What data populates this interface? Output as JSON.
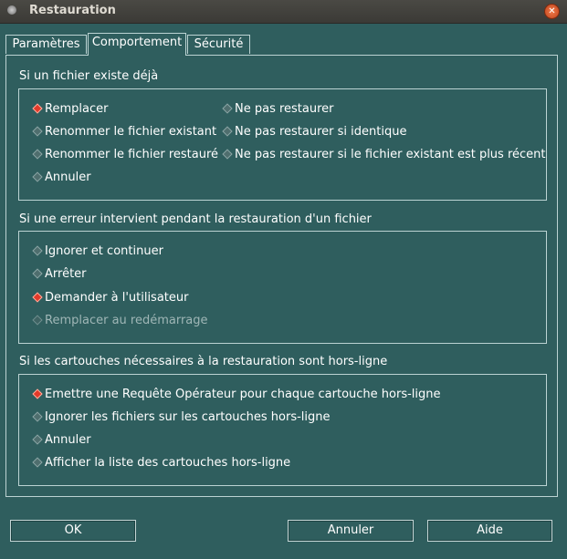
{
  "window": {
    "title": "Restauration"
  },
  "tabs": [
    {
      "label": "Paramètres"
    },
    {
      "label": "Comportement"
    },
    {
      "label": "Sécurité"
    }
  ],
  "sections": [
    {
      "title": "Si un fichier existe déjà",
      "options": [
        {
          "label": "Remplacer",
          "selected": true
        },
        {
          "label": "Renommer le fichier existant",
          "selected": false
        },
        {
          "label": "Renommer le fichier restauré",
          "selected": false
        },
        {
          "label": "Annuler",
          "selected": false
        },
        {
          "label": "Ne pas restaurer",
          "selected": false
        },
        {
          "label": "Ne pas restaurer si identique",
          "selected": false
        },
        {
          "label": "Ne pas restaurer si le fichier existant est plus récent",
          "selected": false
        }
      ]
    },
    {
      "title": "Si une erreur intervient pendant la restauration d'un fichier",
      "options": [
        {
          "label": "Ignorer et continuer",
          "selected": false
        },
        {
          "label": "Arrêter",
          "selected": false
        },
        {
          "label": "Demander à l'utilisateur",
          "selected": true
        },
        {
          "label": "Remplacer au redémarrage",
          "selected": false,
          "disabled": true
        }
      ]
    },
    {
      "title": "Si les cartouches nécessaires à la restauration sont hors-ligne",
      "options": [
        {
          "label": "Emettre une Requête Opérateur pour chaque cartouche hors-ligne",
          "selected": true
        },
        {
          "label": "Ignorer les fichiers sur les cartouches hors-ligne",
          "selected": false
        },
        {
          "label": "Annuler",
          "selected": false
        },
        {
          "label": "Afficher la liste des cartouches hors-ligne",
          "selected": false
        }
      ]
    }
  ],
  "buttons": {
    "ok": "OK",
    "cancel": "Annuler",
    "help": "Aide"
  },
  "colors": {
    "background": "#2f5e5e",
    "selected_radio": "#e23a2a",
    "border": "#bcd3d3"
  }
}
